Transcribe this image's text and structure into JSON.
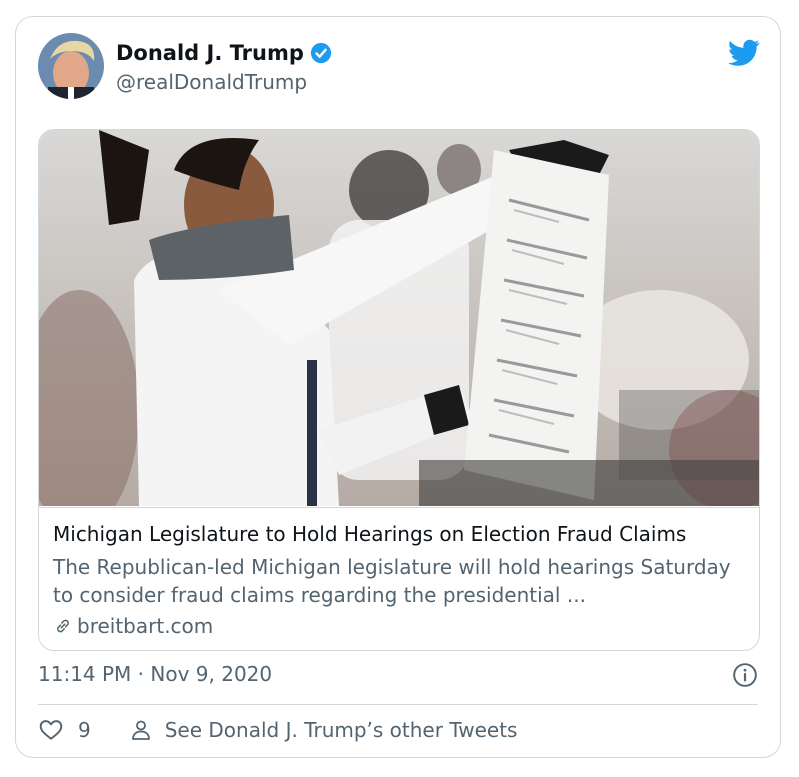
{
  "author": {
    "name": "Donald J. Trump",
    "handle": "@realDonaldTrump",
    "verified": true
  },
  "link_card": {
    "title": "Michigan Legislature to Hold Hearings on Election Fraud Claims",
    "description": "The Republican-led Michigan legislature will hold hearings Saturday to consider fraud claims regarding the presidential ...",
    "domain": "breitbart.com",
    "image_icon": "ballot-photo"
  },
  "timestamp": "11:14 PM · Nov 9, 2020",
  "actions": {
    "like_count": "9",
    "profile_link": "See Donald J. Trump’s other Tweets"
  },
  "colors": {
    "brand": "#1d9bf0",
    "text": "#0f1419",
    "secondary": "#536471",
    "border": "#cfd9de"
  }
}
